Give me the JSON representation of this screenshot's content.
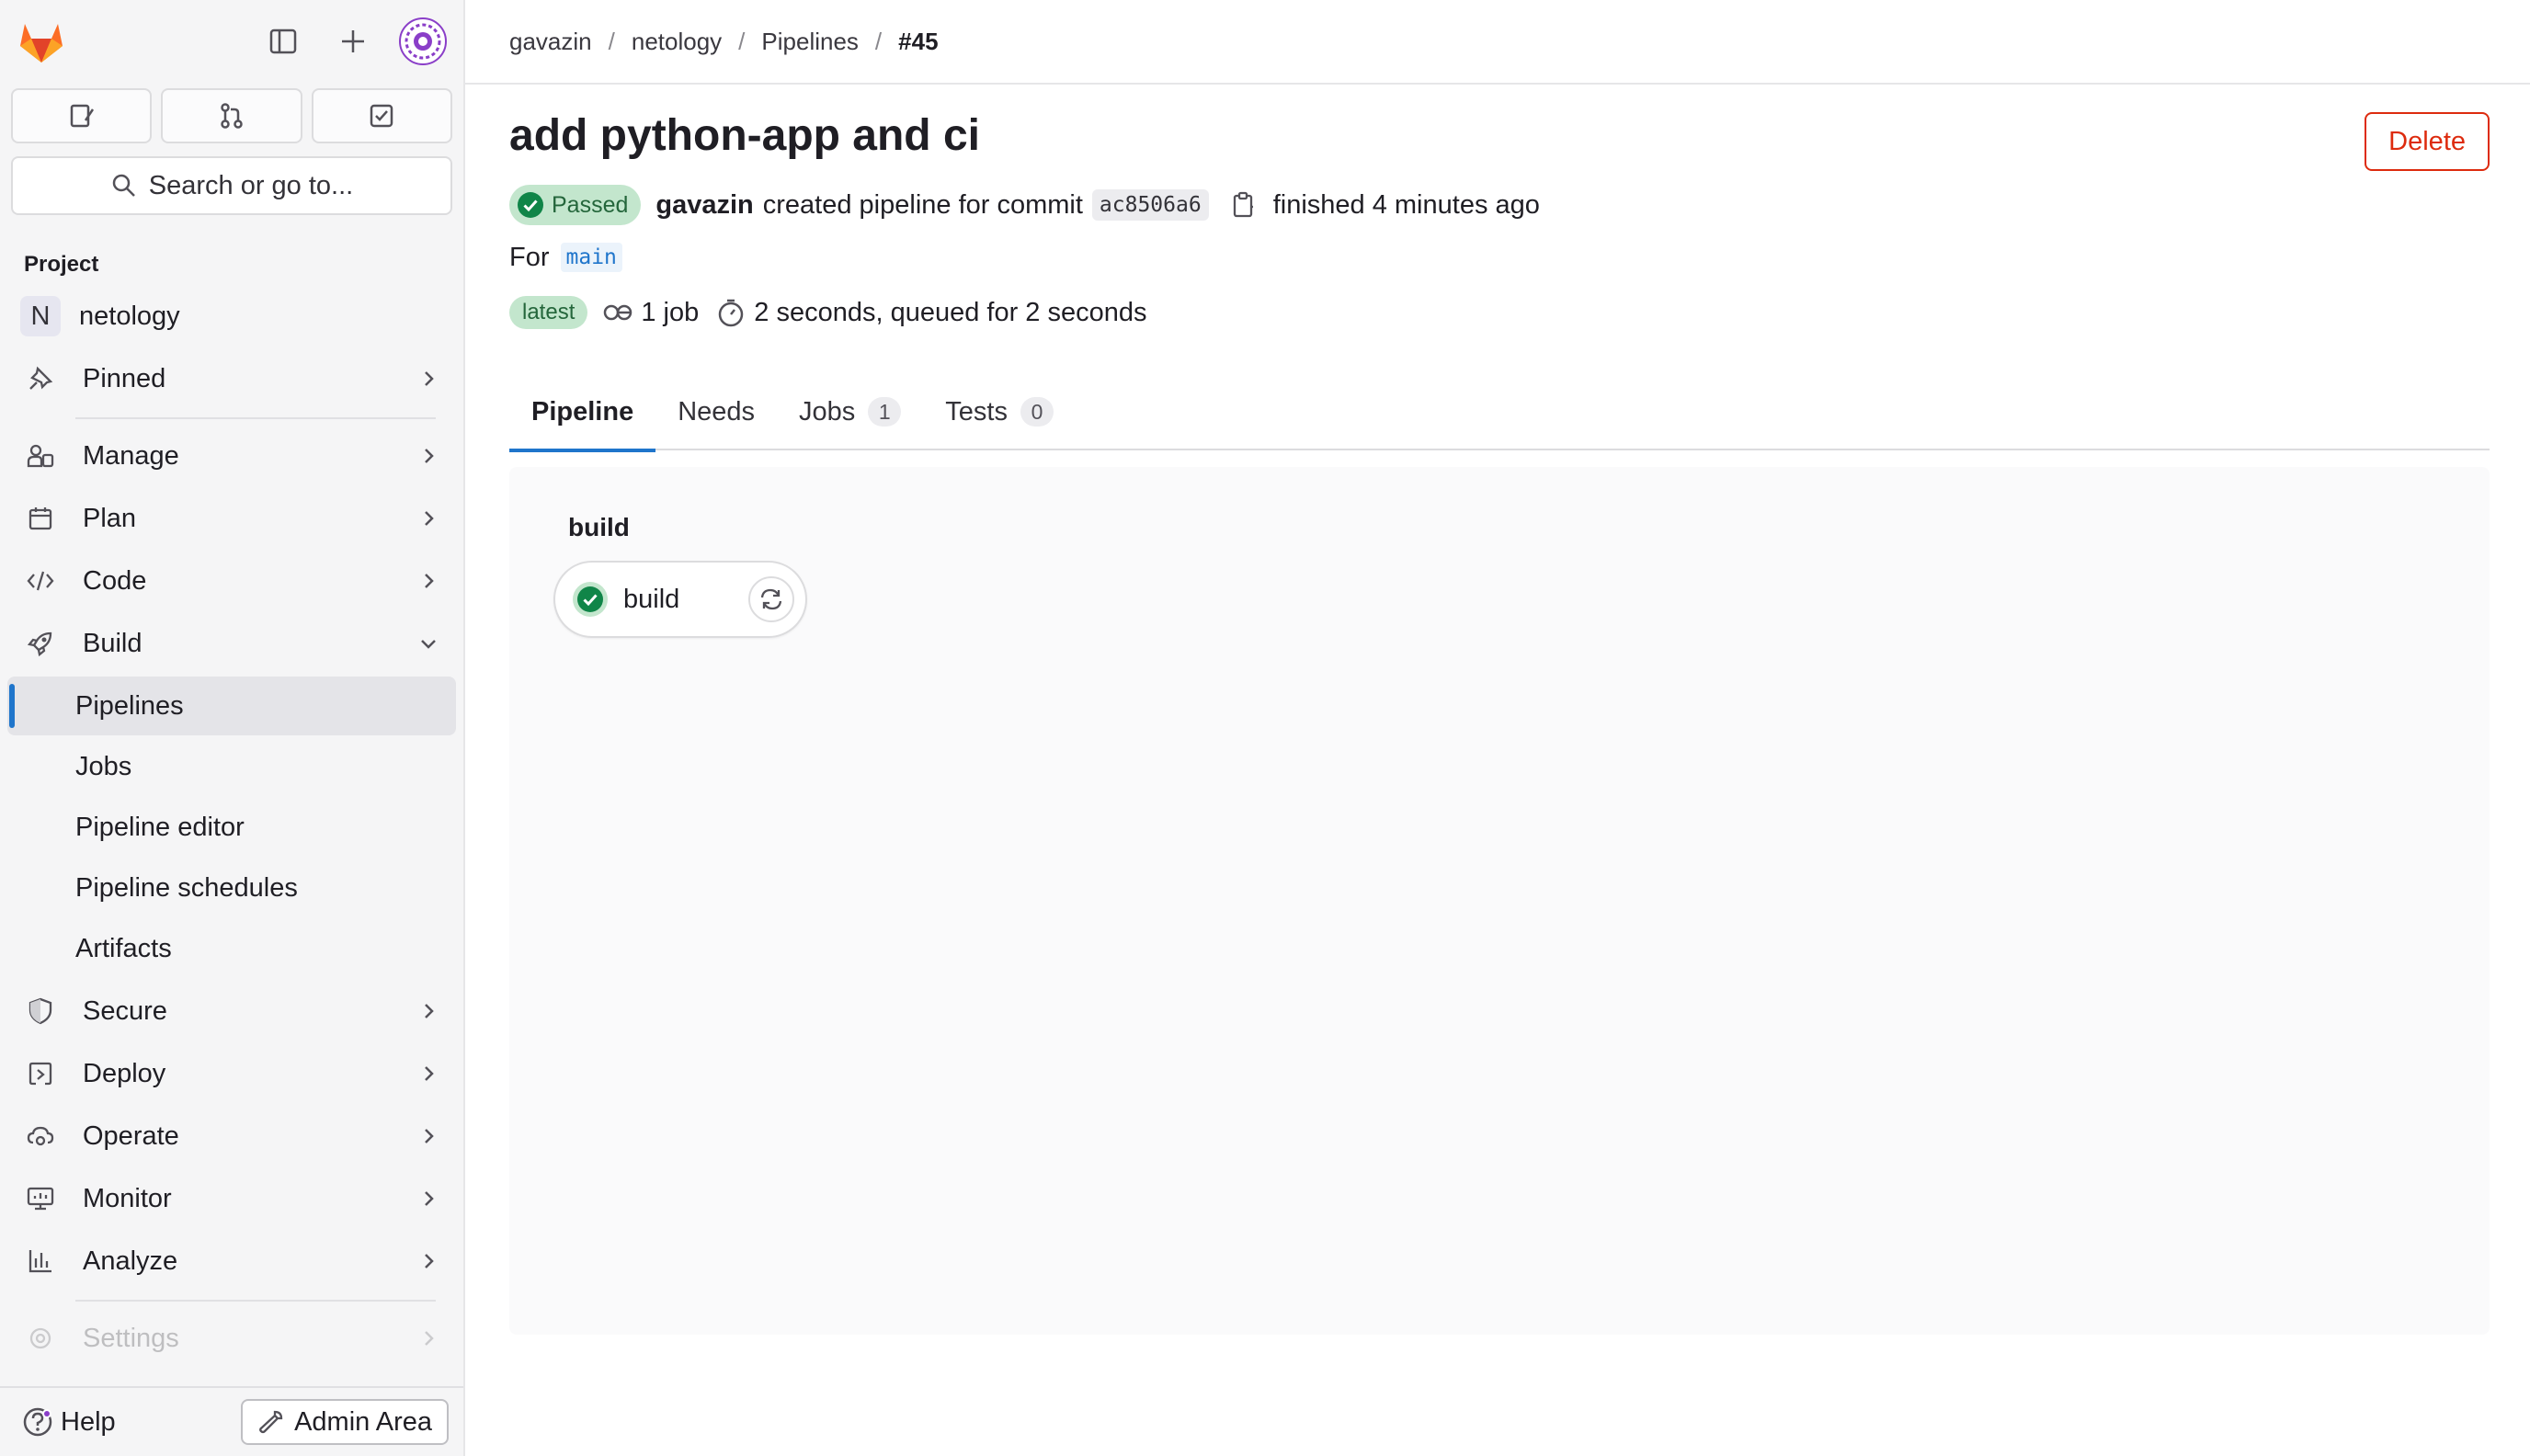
{
  "colors": {
    "accent": "#1f75cb",
    "success": "#108548",
    "success_bg": "#c3e6cd",
    "danger": "#dd2b0e",
    "sidebar_bg": "#f5f5f6"
  },
  "sidebar": {
    "logo_icon": "gitlab-tanuki-icon",
    "top_actions": [
      "sidebar-toggle-icon",
      "plus-icon",
      "avatar"
    ],
    "quick_actions": [
      "issues-icon",
      "merge-requests-icon",
      "todo-icon"
    ],
    "search_label": "Search or go to...",
    "section_label": "Project",
    "project": {
      "badge": "N",
      "name": "netology"
    },
    "items": [
      {
        "label": "Pinned",
        "icon": "pin-icon"
      },
      {
        "label": "Manage",
        "icon": "users-icon"
      },
      {
        "label": "Plan",
        "icon": "calendar-icon"
      },
      {
        "label": "Code",
        "icon": "code-icon"
      },
      {
        "label": "Build",
        "icon": "rocket-icon"
      },
      {
        "label": "Secure",
        "icon": "shield-icon"
      },
      {
        "label": "Deploy",
        "icon": "deploy-icon"
      },
      {
        "label": "Operate",
        "icon": "cloud-gear-icon"
      },
      {
        "label": "Monitor",
        "icon": "monitor-icon"
      },
      {
        "label": "Analyze",
        "icon": "chart-icon"
      },
      {
        "label": "Settings",
        "icon": "settings-icon"
      }
    ],
    "build_subitems": [
      "Pipelines",
      "Jobs",
      "Pipeline editor",
      "Pipeline schedules",
      "Artifacts"
    ],
    "active_subitem": "Pipelines",
    "help_label": "Help",
    "admin_label": "Admin Area"
  },
  "breadcrumb": [
    "gavazin",
    "netology",
    "Pipelines",
    "#45"
  ],
  "pipeline": {
    "title": "add python-app and ci",
    "delete_label": "Delete",
    "status": "Passed",
    "author": "gavazin",
    "created_text": "created pipeline for commit",
    "commit_sha": "ac8506a6",
    "finished_text": "finished 4 minutes ago",
    "for_label": "For",
    "ref": "main",
    "latest_badge": "latest",
    "jobs_text": "1 job",
    "duration_text": "2 seconds, queued for 2 seconds"
  },
  "tabs": [
    {
      "label": "Pipeline",
      "count": null
    },
    {
      "label": "Needs",
      "count": null
    },
    {
      "label": "Jobs",
      "count": "1"
    },
    {
      "label": "Tests",
      "count": "0"
    }
  ],
  "graph": {
    "stage": "build",
    "job": {
      "name": "build",
      "status": "success"
    }
  }
}
